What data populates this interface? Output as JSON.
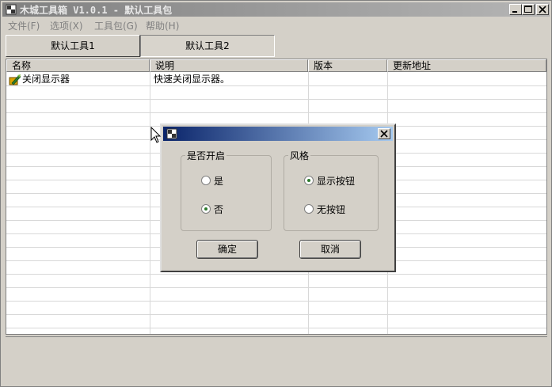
{
  "window": {
    "title": "木城工具箱 V1.0.1 - 默认工具包",
    "caption_buttons": [
      "minimize-icon",
      "maximize-icon",
      "close-icon"
    ]
  },
  "menu": {
    "items": [
      {
        "label": "文件(F)"
      },
      {
        "label": "选项(X)"
      },
      {
        "label": "工具包(G)"
      },
      {
        "label": "帮助(H)"
      }
    ]
  },
  "tabs": [
    {
      "label": "默认工具1",
      "active": false
    },
    {
      "label": "默认工具2",
      "active": true
    }
  ],
  "table": {
    "columns": [
      "名称",
      "说明",
      "版本",
      "更新地址"
    ],
    "rows": [
      {
        "name": "关闭显示器",
        "description": "快速关闭显示器。",
        "version": "",
        "update_url": "",
        "icon": "tool-icon"
      }
    ]
  },
  "dialog": {
    "title": "",
    "enable_group": {
      "label": "是否开启",
      "options": [
        {
          "label": "是",
          "checked": false
        },
        {
          "label": "否",
          "checked": true
        }
      ]
    },
    "style_group": {
      "label": "风格",
      "options": [
        {
          "label": "显示按钮",
          "checked": true
        },
        {
          "label": "无按钮",
          "checked": false
        }
      ]
    },
    "ok_label": "确定",
    "cancel_label": "取消"
  }
}
